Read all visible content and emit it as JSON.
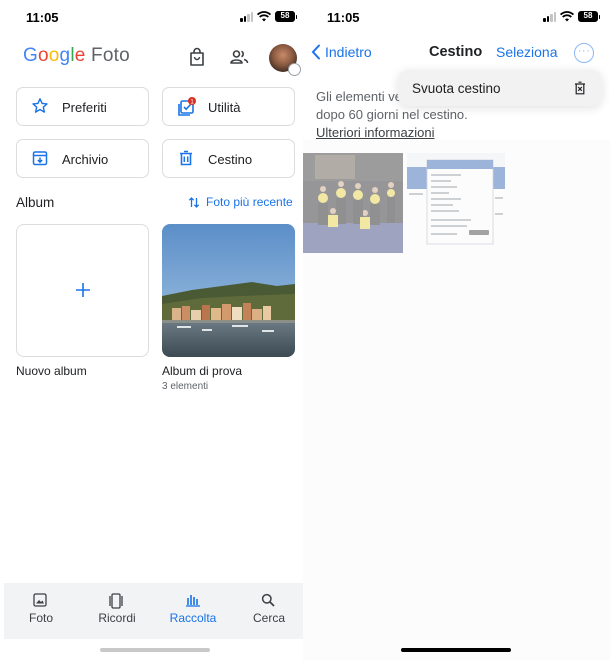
{
  "left": {
    "status": {
      "time": "11:05",
      "battery": "58"
    },
    "header": {
      "logo_google": "Google",
      "logo_product": "Foto"
    },
    "tiles": {
      "favorites": "Preferiti",
      "utilities": "Utilità",
      "utilities_badge": "1",
      "archive": "Archivio",
      "trash": "Cestino"
    },
    "albums_section": {
      "label": "Album",
      "sort_label": "Foto più recente"
    },
    "albums": [
      {
        "name": "Nuovo album",
        "count": ""
      },
      {
        "name": "Album di prova",
        "count": "3 elementi"
      }
    ],
    "bottom_nav": [
      {
        "label": "Foto",
        "icon": "photo-icon"
      },
      {
        "label": "Ricordi",
        "icon": "memories-icon"
      },
      {
        "label": "Raccolta",
        "icon": "library-icon",
        "active": true
      },
      {
        "label": "Cerca",
        "icon": "search-icon"
      }
    ],
    "colors": {
      "accent": "#1a73e8",
      "google_blue": "#4285f4",
      "google_red": "#ea4335",
      "google_yellow": "#fbbc05",
      "google_green": "#34a853"
    }
  },
  "right": {
    "status": {
      "time": "11:05",
      "battery": "58"
    },
    "header": {
      "back_label": "Indietro",
      "title": "Cestino",
      "select_label": "Seleziona"
    },
    "info": {
      "line1": "Gli elementi ve",
      "line2": "dopo 60 giorni nel cestino.",
      "link": "Ulteriori informazioni"
    },
    "menu": {
      "empty_trash_label": "Svuota cestino"
    }
  }
}
